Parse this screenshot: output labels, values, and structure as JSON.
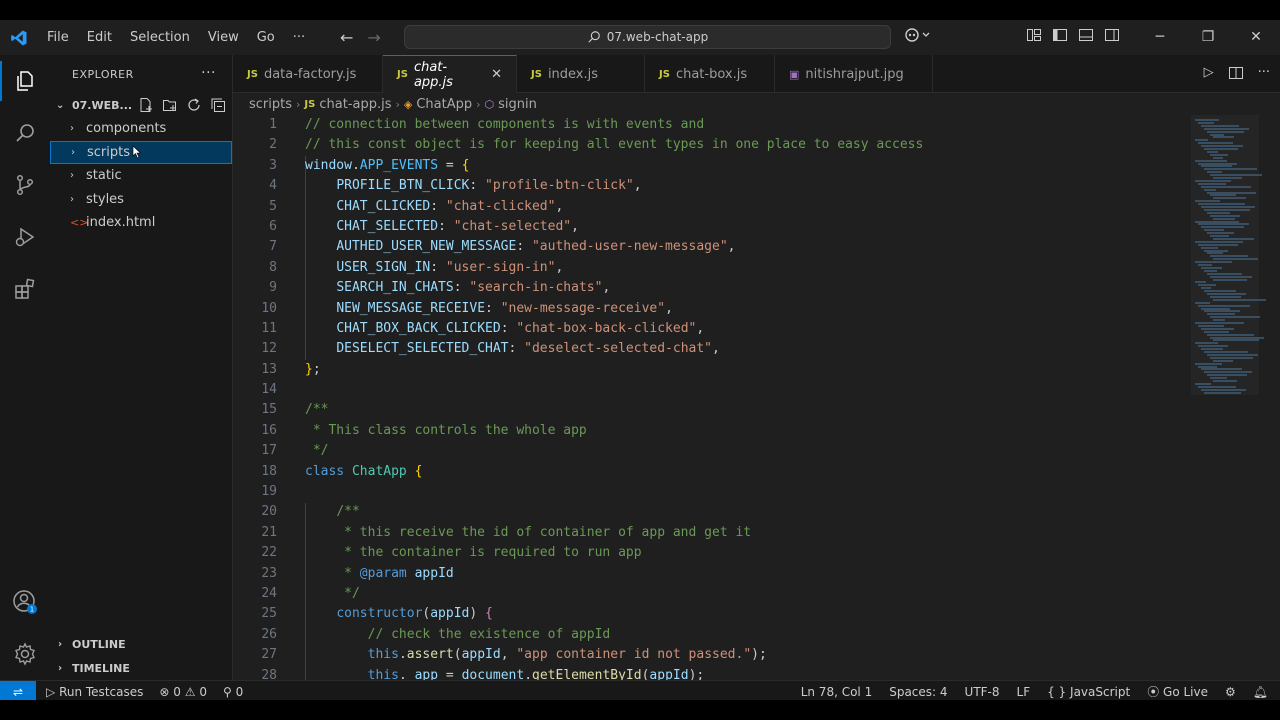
{
  "titlebar": {
    "menu": [
      "File",
      "Edit",
      "Selection",
      "View",
      "Go",
      "···"
    ],
    "search": "07.web-chat-app"
  },
  "sidebar": {
    "title": "EXPLORER",
    "project": "07.WEB...",
    "items": [
      {
        "label": "components",
        "kind": "folder"
      },
      {
        "label": "scripts",
        "kind": "folder",
        "selected": true
      },
      {
        "label": "static",
        "kind": "folder"
      },
      {
        "label": "styles",
        "kind": "folder"
      },
      {
        "label": "index.html",
        "kind": "html"
      }
    ],
    "outline": "OUTLINE",
    "timeline": "TIMELINE"
  },
  "tabs": [
    {
      "label": "data-factory.js",
      "icon": "JS"
    },
    {
      "label": "chat-app.js",
      "icon": "JS",
      "active": true
    },
    {
      "label": "index.js",
      "icon": "JS"
    },
    {
      "label": "chat-box.js",
      "icon": "JS"
    },
    {
      "label": "nitishrajput.jpg",
      "icon": "image"
    }
  ],
  "breadcrumb": {
    "folder": "scripts",
    "file": "chat-app.js",
    "class": "ChatApp",
    "method": "signin"
  },
  "editor": {
    "line_numbers": [
      "1",
      "2",
      "3",
      "4",
      "5",
      "6",
      "7",
      "8",
      "9",
      "10",
      "11",
      "12",
      "13",
      "14",
      "15",
      "16",
      "17",
      "18",
      "19",
      "20",
      "21",
      "22",
      "23",
      "24",
      "25",
      "26",
      "27",
      "28"
    ]
  },
  "status": {
    "run": "Run Testcases",
    "errors": "0",
    "warnings": "0",
    "ports": "0",
    "position": "Ln 78, Col 1",
    "spaces": "Spaces: 4",
    "encoding": "UTF-8",
    "eol": "LF",
    "language": "JavaScript",
    "golive": "Go Live"
  },
  "colors": {
    "accent": "#0078d4",
    "editor_bg": "#1f1f1f",
    "sidebar_bg": "#181818"
  }
}
